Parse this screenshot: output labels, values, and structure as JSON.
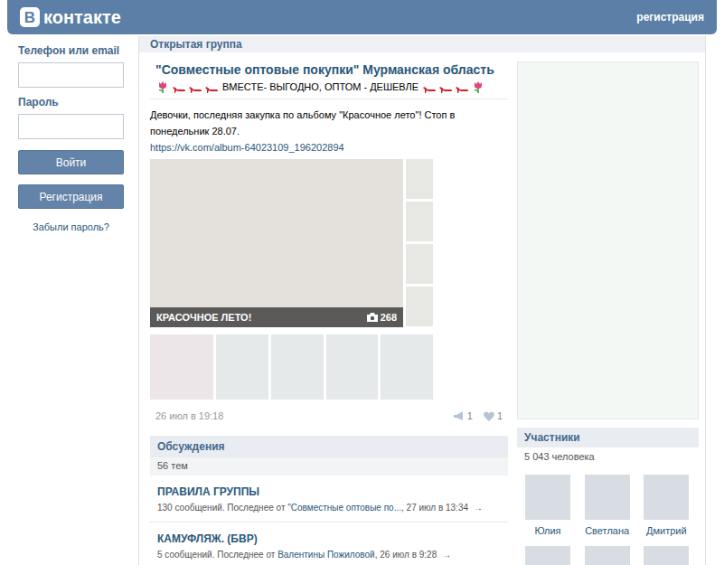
{
  "header": {
    "logo_letter": "В",
    "logo_text": "контакте",
    "register_link": "регистрация"
  },
  "login": {
    "phone_label": "Телефон или email",
    "password_label": "Пароль",
    "login_button": "Войти",
    "register_button": "Регистрация",
    "forgot_link": "Забыли пароль?"
  },
  "page_header": "Открытая группа",
  "group": {
    "title": "\"Совместные оптовые покупки\" Мурманская область",
    "status": "ВМЕСТЕ- ВЫГОДНО, ОПТОМ - ДЕШЕВЛЕ"
  },
  "post": {
    "text": "Девочки, последняя закупка по альбому \"Красочное лето\"! Стоп в понедельник 28.07.",
    "link": "https://vk.com/album-64023109_196202894",
    "album": {
      "title": "КРАСОЧНОЕ ЛЕТО!",
      "count": "268"
    },
    "date": "26 июл в 19:18",
    "shares": "1",
    "likes": "1"
  },
  "discussions": {
    "title": "Обсуждения",
    "count": "56 тем",
    "topics": [
      {
        "title": "ПРАВИЛА ГРУППЫ",
        "meta": "130 сообщений. Последнее от ",
        "author": "\"Совместные оптовые по...",
        "time": ", 27 июл в 13:34",
        "arrow": "→"
      },
      {
        "title": "КАМУФЛЯЖ. (БВР)",
        "meta": "5 сообщений. Последнее от ",
        "author": "Валентины Пожиловой",
        "time": ", 26 июл в 9:28",
        "arrow": "→"
      }
    ]
  },
  "members": {
    "title": "Участники",
    "count": "5 043 человека",
    "people": [
      {
        "name": "Юлия"
      },
      {
        "name": "Светлана"
      },
      {
        "name": "Дмитрий"
      }
    ]
  }
}
